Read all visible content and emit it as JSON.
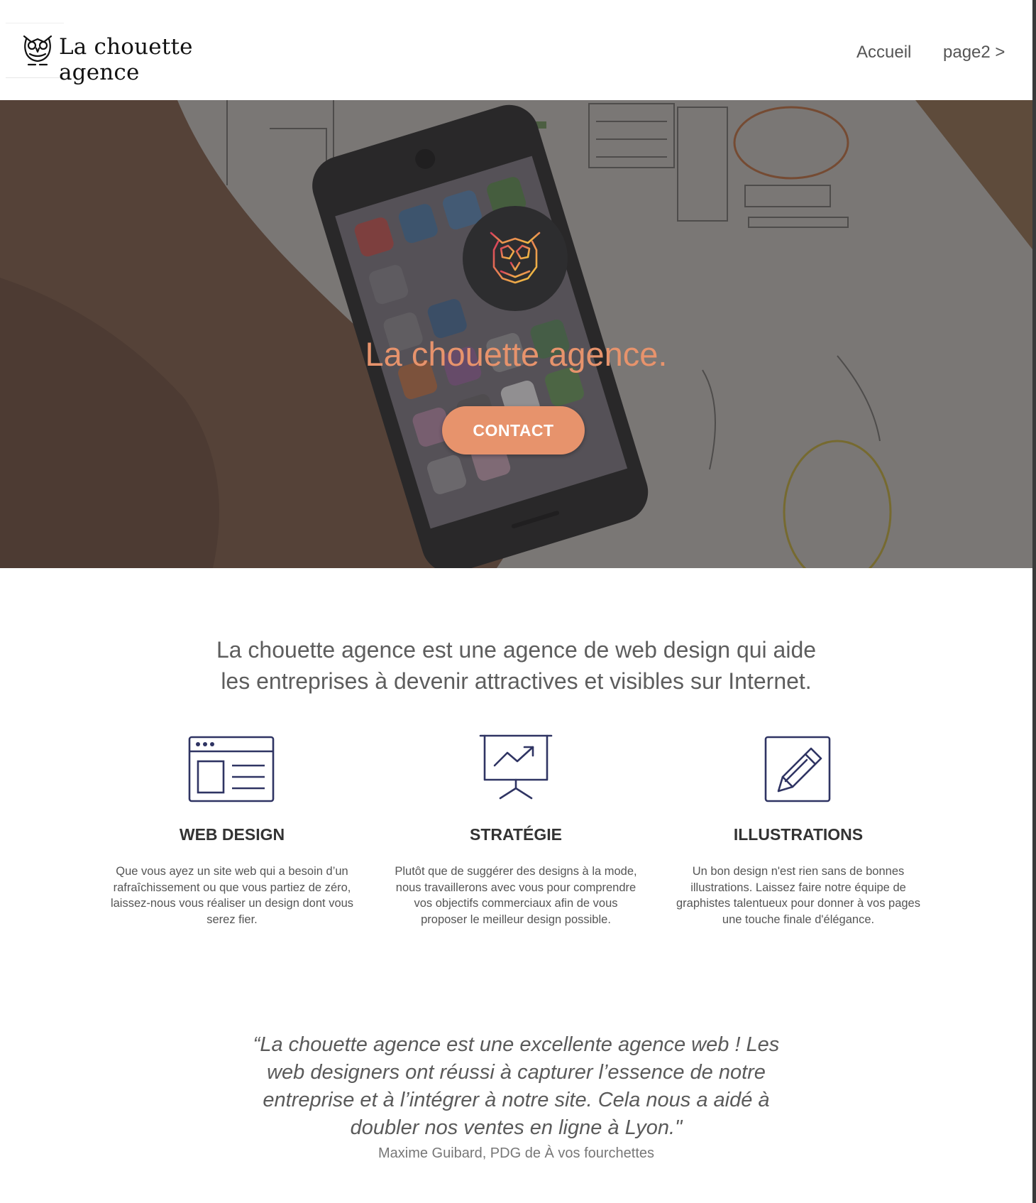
{
  "header": {
    "logo_text": "La chouette agence",
    "nav": [
      {
        "label": "Accueil"
      },
      {
        "label": "page2 >"
      }
    ]
  },
  "hero": {
    "title": "La chouette agence.",
    "contact_label": "CONTACT",
    "icon": "owl-logo-icon",
    "accent_color": "#e7936c"
  },
  "intro": {
    "line1": "La chouette agence est une agence de web design qui aide",
    "line2": "les entreprises à devenir attractives et visibles sur Internet."
  },
  "features": [
    {
      "icon": "web-layout-icon",
      "title": "WEB DESIGN",
      "lines": [
        "Que vous ayez un site web qui a besoin d’un",
        "rafraîchissement ou que vous partiez de zéro,",
        "laissez-nous vous réaliser un design dont vous",
        "serez fier."
      ]
    },
    {
      "icon": "presentation-chart-icon",
      "title": "STRATÉGIE",
      "lines": [
        "Plutôt que de suggérer des designs à la mode,",
        "nous travaillerons avec vous pour comprendre",
        "vos objectifs commerciaux afin de vous",
        "proposer le meilleur design possible."
      ]
    },
    {
      "icon": "pencil-icon",
      "title": "ILLUSTRATIONS",
      "lines": [
        "Un bon design n'est rien sans de bonnes",
        "illustrations. Laissez faire notre équipe de",
        "graphistes talentueux pour donner à vos pages",
        "une touche finale d'élégance."
      ]
    }
  ],
  "testimonial": {
    "lines": [
      "“La chouette agence est une excellente agence web ! Les",
      "web designers ont réussi à capturer l’essence de notre",
      "entreprise et à l’intégrer à notre site. Cela nous a aidé à",
      "doubler nos ventes en ligne à Lyon.\""
    ],
    "author": "Maxime Guibard, PDG de À vos fourchettes"
  },
  "colors": {
    "icon_stroke": "#2f3463",
    "text_gray": "#5d5d5d"
  }
}
